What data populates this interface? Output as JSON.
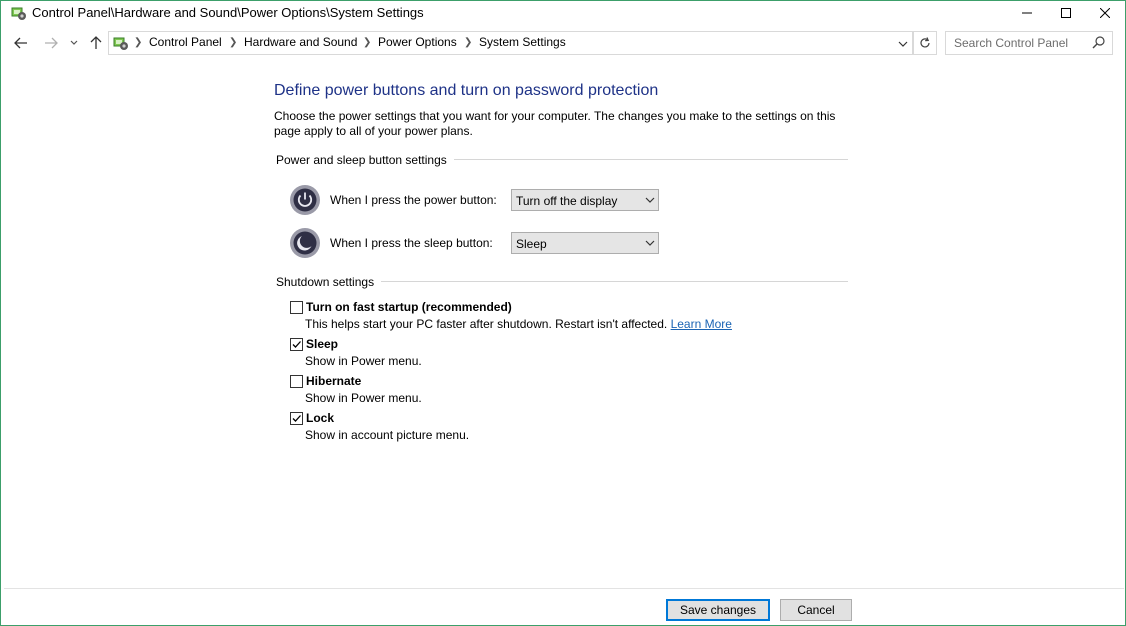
{
  "window": {
    "title": "Control Panel\\Hardware and Sound\\Power Options\\System Settings",
    "controls": {
      "minimize": "minimize-icon",
      "maximize": "maximize-icon",
      "close": "close-icon"
    }
  },
  "nav": {
    "breadcrumbs": [
      "Control Panel",
      "Hardware and Sound",
      "Power Options",
      "System Settings"
    ],
    "search_placeholder": "Search Control Panel"
  },
  "main": {
    "heading": "Define power buttons and turn on password protection",
    "description": "Choose the power settings that you want for your computer. The changes you make to the settings on this page apply to all of your power plans.",
    "power_group": {
      "title": "Power and sleep button settings",
      "power_button_label": "When I press the power button:",
      "power_button_value": "Turn off the display",
      "sleep_button_label": "When I press the sleep button:",
      "sleep_button_value": "Sleep"
    },
    "shutdown_group": {
      "title": "Shutdown settings",
      "items": [
        {
          "label": "Turn on fast startup (recommended)",
          "desc": "This helps start your PC faster after shutdown. Restart isn't affected.",
          "link": "Learn More",
          "checked": false
        },
        {
          "label": "Sleep",
          "desc": "Show in Power menu.",
          "checked": true
        },
        {
          "label": "Hibernate",
          "desc": "Show in Power menu.",
          "checked": false
        },
        {
          "label": "Lock",
          "desc": "Show in account picture menu.",
          "checked": true
        }
      ]
    }
  },
  "footer": {
    "save_label": "Save changes",
    "cancel_label": "Cancel"
  },
  "colors": {
    "heading": "#1e3287",
    "link": "#1b64b4",
    "window_border": "#3c9f6a",
    "focus": "#0078d7"
  }
}
